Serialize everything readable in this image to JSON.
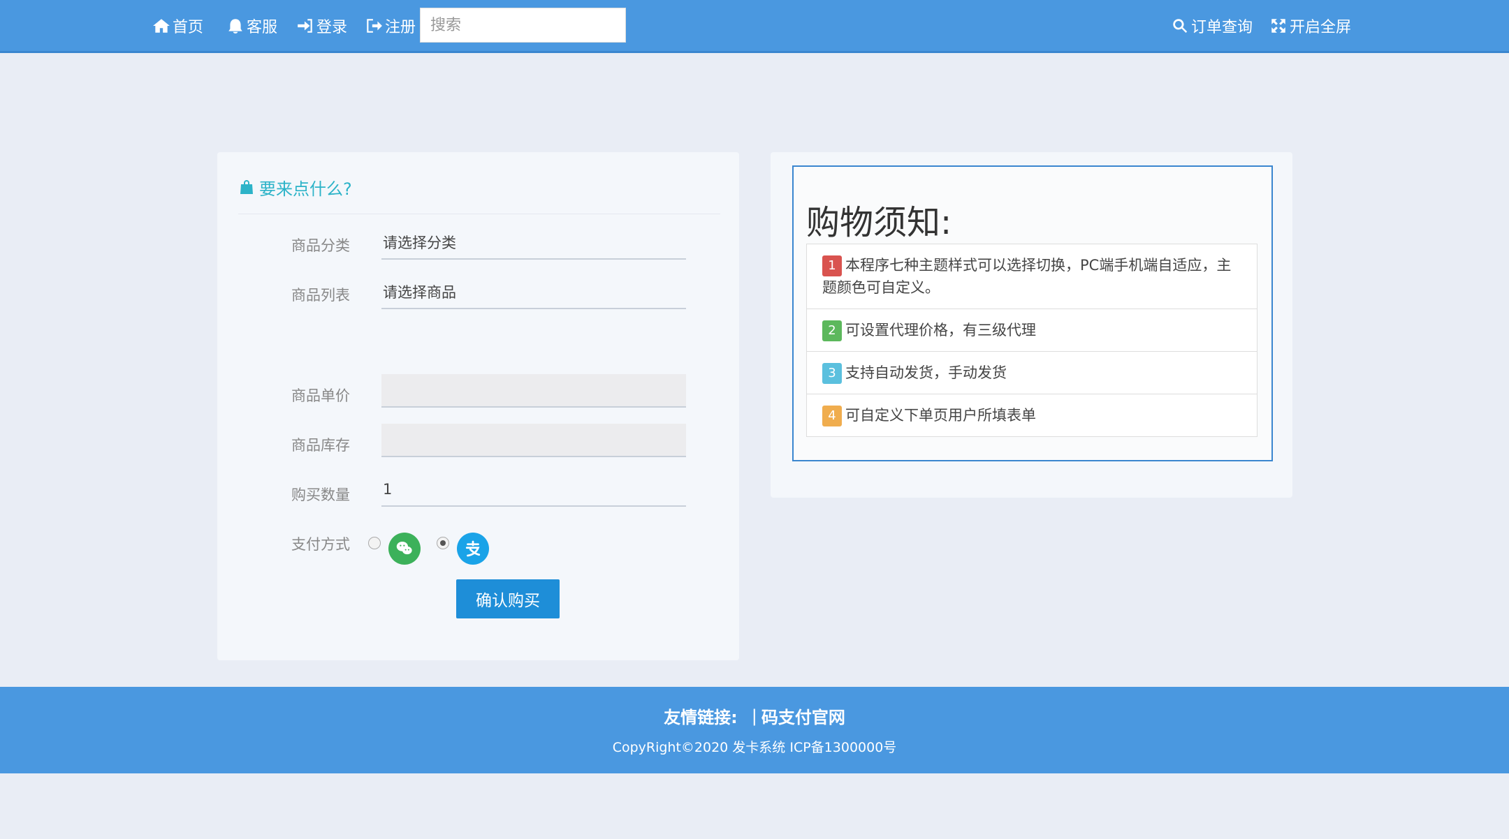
{
  "nav": {
    "home": {
      "label": "首页",
      "icon": "home-icon"
    },
    "service": {
      "label": "客服",
      "icon": "bell-icon"
    },
    "login": {
      "label": "登录",
      "icon": "sign-in-icon"
    },
    "register": {
      "label": "注册",
      "icon": "sign-out-icon"
    },
    "search_placeholder": "搜索",
    "order_query": {
      "label": "订单查询",
      "icon": "search-icon"
    },
    "fullscreen": {
      "label": "开启全屏",
      "icon": "expand-icon"
    }
  },
  "order_form": {
    "title": "要来点什么?",
    "title_icon": "shopping-bag-icon",
    "category_label": "商品分类",
    "category_value": "请选择分类",
    "product_label": "商品列表",
    "product_value": "请选择商品",
    "price_label": "商品单价",
    "price_value": "",
    "stock_label": "商品库存",
    "stock_value": "",
    "quantity_label": "购买数量",
    "quantity_value": "1",
    "payment_label": "支付方式",
    "payment_options": [
      {
        "icon": "wechat-icon",
        "selected": false,
        "color": "#3cb15a"
      },
      {
        "icon": "alipay-icon",
        "selected": true,
        "color": "#1aa3e8"
      }
    ],
    "confirm_label": "确认购买"
  },
  "notice": {
    "title": "购物须知:",
    "items": [
      {
        "num": "1",
        "text": "本程序七种主题样式可以选择切换，PC端手机端自适应，主题颜色可自定义。",
        "color": "#d9534f"
      },
      {
        "num": "2",
        "text": "可设置代理价格，有三级代理",
        "color": "#5cb85c"
      },
      {
        "num": "3",
        "text": "支持自动发货，手动发货",
        "color": "#5bc0de"
      },
      {
        "num": "4",
        "text": "可自定义下单页用户所填表单",
        "color": "#f0ad4e"
      }
    ]
  },
  "footer": {
    "links_label": "友情链接:",
    "separator": "|",
    "link": "码支付官网",
    "copyright": "CopyRight©2020 发卡系统 ICP备1300000号"
  },
  "colors": {
    "primary": "#4a98e0",
    "accent": "#2cb3c8",
    "button": "#1e8ed8"
  }
}
